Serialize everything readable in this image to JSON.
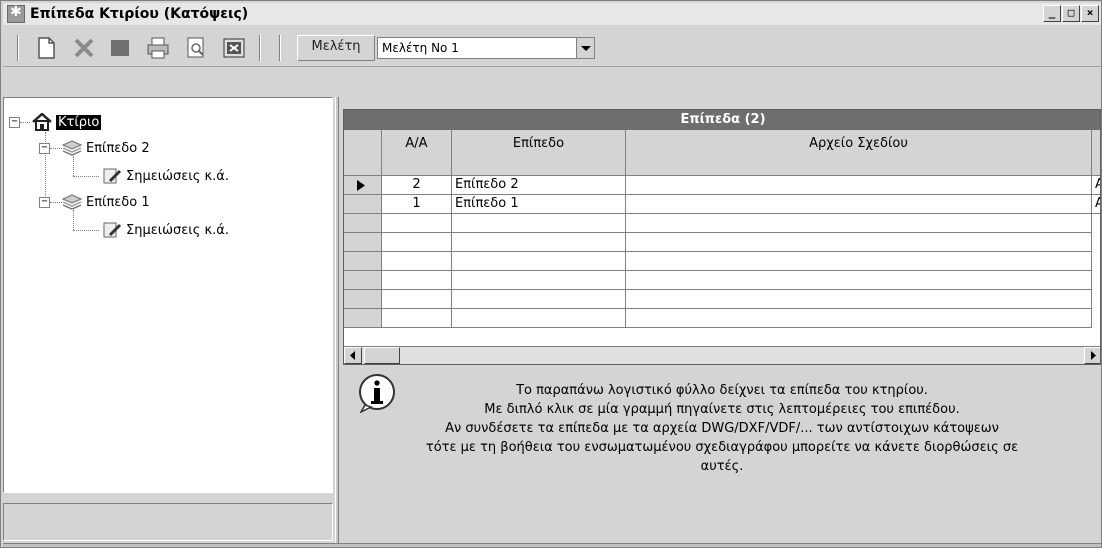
{
  "window": {
    "title": "Επίπεδα Κτιρίου (Κατόψεις)",
    "controls": [
      "_",
      "□",
      "×"
    ]
  },
  "toolbar": {
    "label": "Μελέτη",
    "combo_value": "Μελέτη Νο 1",
    "icons": [
      "new-document-icon",
      "delete-icon",
      "stop-icon",
      "print-icon",
      "preview-icon",
      "close-sheet-icon"
    ]
  },
  "tree": {
    "root": "Κτίριο",
    "levels": [
      {
        "label": "Επίπεδο 2",
        "child": "Σημειώσεις κ.ά."
      },
      {
        "label": "Επίπεδο 1",
        "child": "Σημειώσεις κ.ά."
      }
    ]
  },
  "grid": {
    "caption": "Επίπεδα  (2)",
    "columns": [
      "Α/Α",
      "Επίπεδο",
      "Αρχείο Σχεδίου"
    ],
    "rows": [
      {
        "aa": "2",
        "level": "Επίπεδο 2",
        "file": "",
        "extra": "A"
      },
      {
        "aa": "1",
        "level": "Επίπεδο 1",
        "file": "",
        "extra": "A"
      }
    ]
  },
  "info": {
    "lines": [
      "Το παραπάνω λογιστικό φύλλο δείχνει τα επίπεδα του κτηρίου.",
      "Με διπλό κλικ σε μία γραμμή πηγαίνετε στις λεπτομέρειες του επιπέδου.",
      "Αν συνδέσετε τα επίπεδα με τα αρχεία DWG/DXF/VDF/... των αντίστοιχων κάτοψεων",
      "τότε με τη βοήθεια του ενσωματωμένου σχεδιαγράφου μπορείτε να κάνετε διορθώσεις σε",
      "αυτές."
    ]
  }
}
